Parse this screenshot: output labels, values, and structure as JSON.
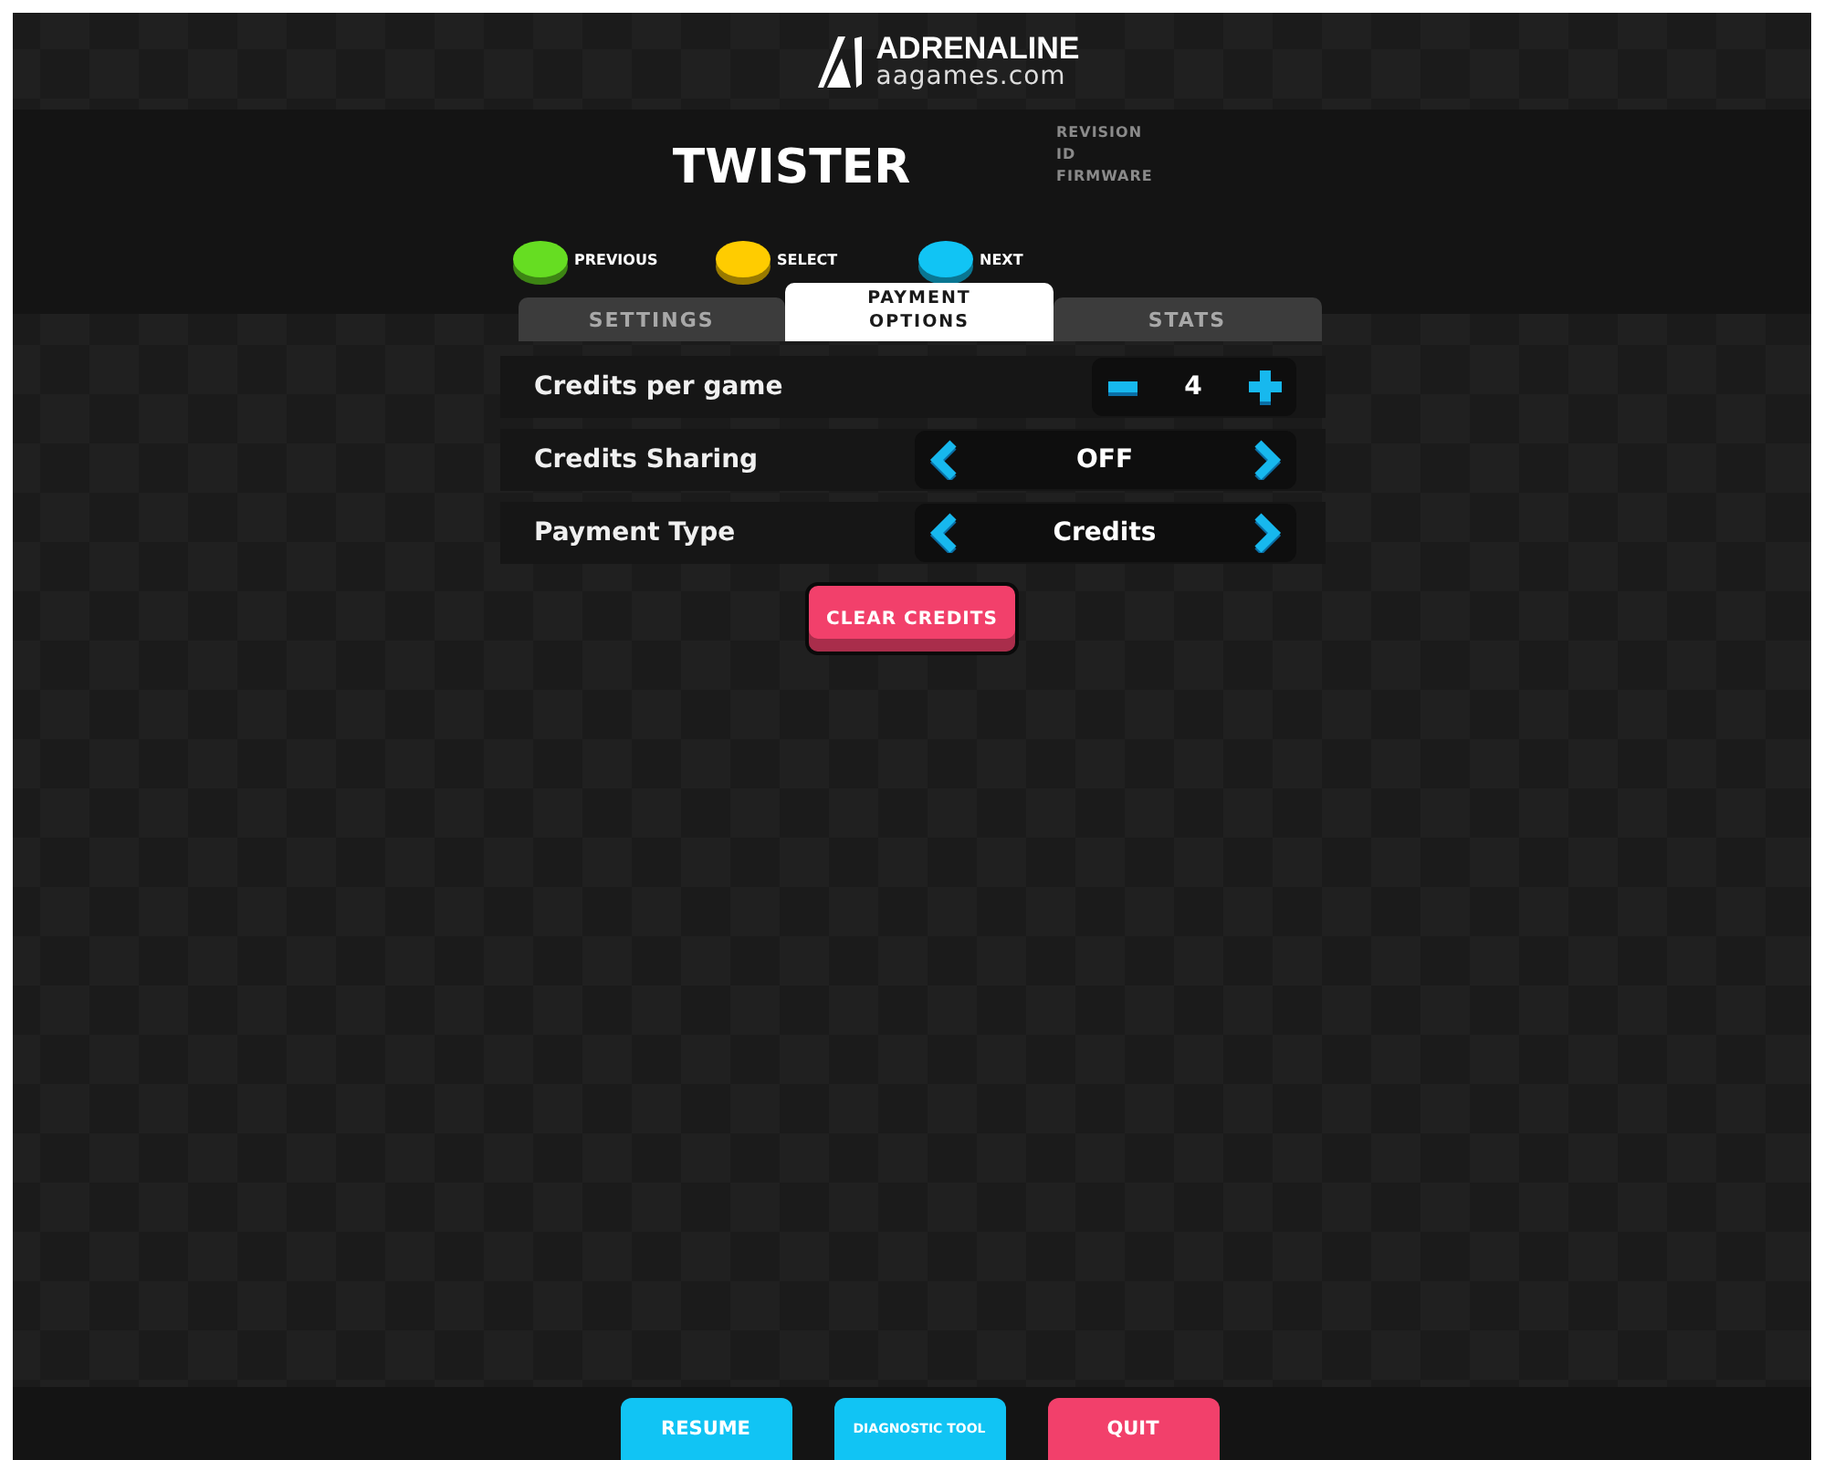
{
  "logo": {
    "name": "ADRENALINE",
    "site": "aagames.com"
  },
  "header": {
    "title": "TWISTER",
    "info": [
      "REVISION",
      "ID",
      "FIRMWARE"
    ],
    "hints": [
      {
        "label": "PREVIOUS",
        "color": "#66dd22"
      },
      {
        "label": "SELECT",
        "color": "#ffcc00"
      },
      {
        "label": "NEXT",
        "color": "#11c4f4"
      }
    ]
  },
  "tabs": [
    {
      "label": "SETTINGS",
      "selected": false
    },
    {
      "label": "PAYMENT OPTIONS",
      "selected": true
    },
    {
      "label": "STATS",
      "selected": false
    }
  ],
  "settings": [
    {
      "kind": "stepper",
      "label": "Credits per game",
      "value": "4"
    },
    {
      "kind": "selector",
      "label": "Credits Sharing",
      "value": "OFF"
    },
    {
      "kind": "selector",
      "label": "Payment Type",
      "value": "Credits"
    }
  ],
  "clear_button": {
    "label": "CLEAR CREDITS",
    "color": "#f2406b"
  },
  "footer_buttons": [
    {
      "label": "RESUME",
      "color": "#11c4f4"
    },
    {
      "label": "DIAGNOSTIC TOOL",
      "color": "#11c4f4"
    },
    {
      "label": "QUIT",
      "color": "#f2406b"
    }
  ]
}
